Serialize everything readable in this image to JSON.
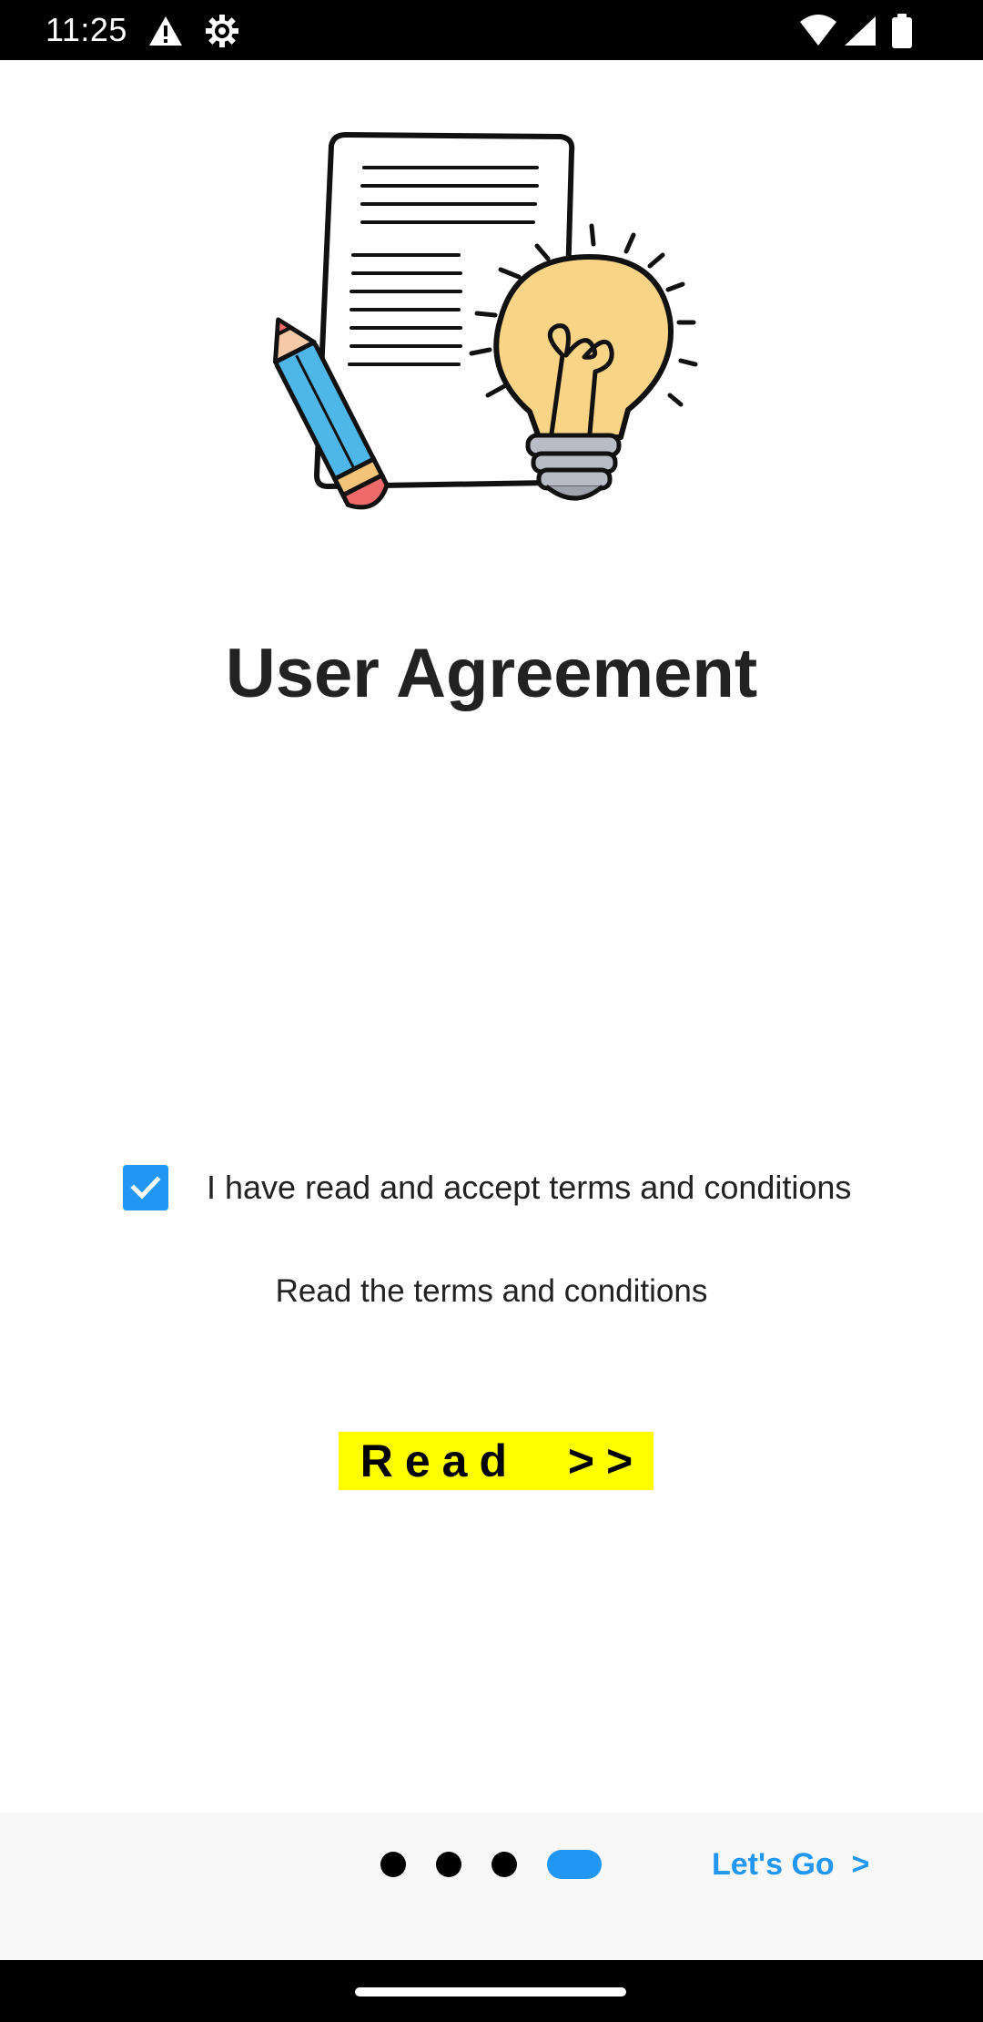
{
  "status_bar": {
    "time": "11:25",
    "icons": [
      "warning-icon",
      "settings-gear-icon",
      "wifi-icon",
      "signal-icon",
      "battery-icon"
    ]
  },
  "illustration": {
    "name": "document-pencil-lightbulb-illustration"
  },
  "page": {
    "title": "User Agreement"
  },
  "agreement": {
    "checked": true,
    "label": "I have read and accept terms and conditions",
    "hint": "Read the terms and conditions",
    "read_button_label": "Read  >>",
    "read_button_color": "#ffff00"
  },
  "pager": {
    "page_count": 4,
    "active_index": 3,
    "next_label": "Let's Go  >"
  },
  "colors": {
    "accent": "#2196f3",
    "title_text": "#222222",
    "status_bar": "#000000",
    "bottom_bar": "#f8f8f8"
  }
}
